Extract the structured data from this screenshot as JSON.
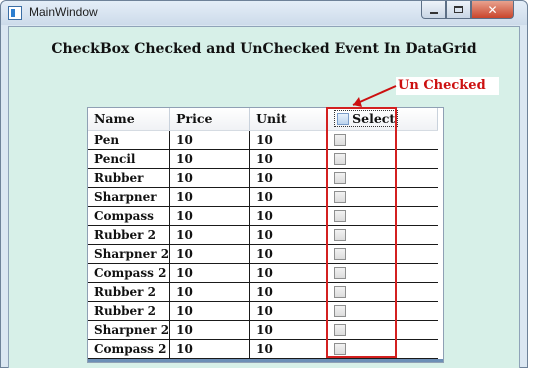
{
  "window": {
    "title": "MainWindow",
    "controls": {
      "minimize": "minimize",
      "maximize": "maximize",
      "close": "close"
    }
  },
  "page": {
    "heading": "CheckBox Checked and UnChecked Event In DataGrid",
    "annotation": "Un Checked"
  },
  "grid": {
    "columns": [
      "Name",
      "Price",
      "Unit",
      "Select"
    ],
    "rows": [
      {
        "name": "Pen",
        "price": "10",
        "unit": "10",
        "selected": false
      },
      {
        "name": "Pencil",
        "price": "10",
        "unit": "10",
        "selected": false
      },
      {
        "name": "Rubber",
        "price": "10",
        "unit": "10",
        "selected": false
      },
      {
        "name": "Sharpner",
        "price": "10",
        "unit": "10",
        "selected": false
      },
      {
        "name": "Compass",
        "price": "10",
        "unit": "10",
        "selected": false
      },
      {
        "name": "Rubber 2",
        "price": "10",
        "unit": "10",
        "selected": false
      },
      {
        "name": "Sharpner 2",
        "price": "10",
        "unit": "10",
        "selected": false
      },
      {
        "name": "Compass 2",
        "price": "10",
        "unit": "10",
        "selected": false
      },
      {
        "name": "Rubber 2",
        "price": "10",
        "unit": "10",
        "selected": false
      },
      {
        "name": "Rubber 2",
        "price": "10",
        "unit": "10",
        "selected": false
      },
      {
        "name": "Sharpner 2",
        "price": "10",
        "unit": "10",
        "selected": false
      },
      {
        "name": "Compass 2",
        "price": "10",
        "unit": "10",
        "selected": false
      }
    ]
  },
  "colors": {
    "client_background": "#d7f0e8",
    "annotation": "#cc1010",
    "highlight_border": "#d32020"
  }
}
